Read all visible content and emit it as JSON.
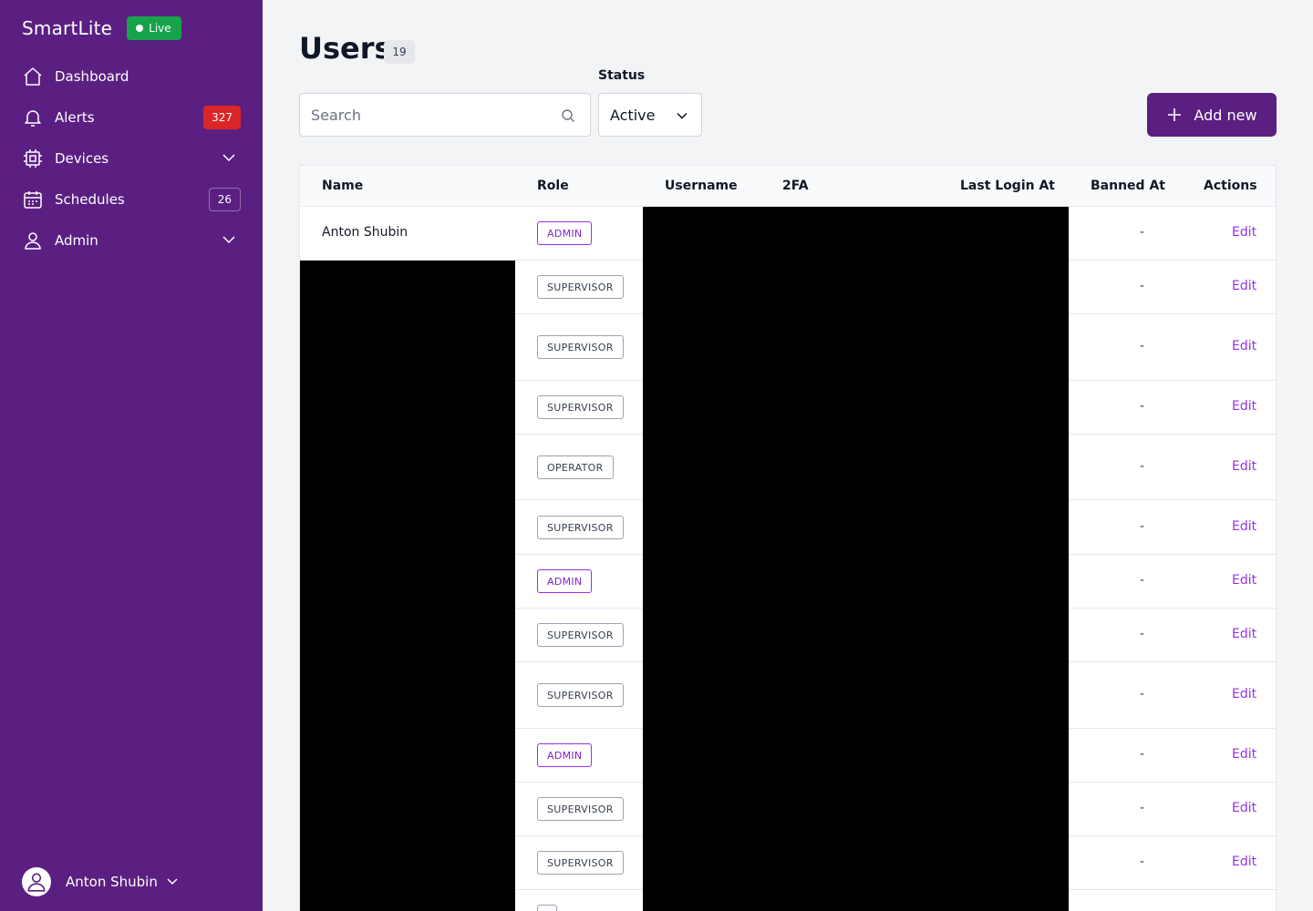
{
  "brand": {
    "name": "SmartLite",
    "live_label": "Live"
  },
  "sidebar": {
    "items": [
      {
        "label": "Dashboard",
        "icon": "home-icon"
      },
      {
        "label": "Alerts",
        "icon": "bell-icon",
        "count": "327"
      },
      {
        "label": "Devices",
        "icon": "chip-icon"
      },
      {
        "label": "Schedules",
        "icon": "calendar-icon",
        "count": "26"
      },
      {
        "label": "Admin",
        "icon": "user-icon"
      }
    ],
    "user_name": "Anton Shubin"
  },
  "page": {
    "title": "Users",
    "count": "19"
  },
  "search": {
    "placeholder": "Search"
  },
  "filter": {
    "label": "Status",
    "value": "Active"
  },
  "add_button": {
    "label": "Add new"
  },
  "table": {
    "headers": {
      "name": "Name",
      "role": "Role",
      "username": "Username",
      "twofa": "2FA",
      "last_login": "Last Login At",
      "banned": "Banned At",
      "actions": "Actions"
    },
    "rows": [
      {
        "name": "Anton Shubin",
        "role": "ADMIN",
        "banned": "-",
        "action": "Edit"
      },
      {
        "name": "",
        "role": "SUPERVISOR",
        "banned": "-",
        "action": "Edit"
      },
      {
        "name": "",
        "role": "SUPERVISOR",
        "banned": "-",
        "action": "Edit"
      },
      {
        "name": "",
        "role": "SUPERVISOR",
        "banned": "-",
        "action": "Edit"
      },
      {
        "name": "",
        "role": "OPERATOR",
        "banned": "-",
        "action": "Edit"
      },
      {
        "name": "",
        "role": "SUPERVISOR",
        "banned": "-",
        "action": "Edit"
      },
      {
        "name": "",
        "role": "ADMIN",
        "banned": "-",
        "action": "Edit"
      },
      {
        "name": "",
        "role": "SUPERVISOR",
        "banned": "-",
        "action": "Edit"
      },
      {
        "name": "",
        "role": "SUPERVISOR",
        "banned": "-",
        "action": "Edit"
      },
      {
        "name": "",
        "role": "ADMIN",
        "banned": "-",
        "action": "Edit"
      },
      {
        "name": "",
        "role": "SUPERVISOR",
        "banned": "-",
        "action": "Edit"
      },
      {
        "name": "",
        "role": "SUPERVISOR",
        "banned": "-",
        "action": "Edit"
      },
      {
        "name": "",
        "role": "",
        "banned": "",
        "action": ""
      }
    ]
  },
  "colors": {
    "sidebar": "#5b1f82",
    "accent": "#9333ea",
    "alert": "#dc2626",
    "live": "#16a34a"
  }
}
